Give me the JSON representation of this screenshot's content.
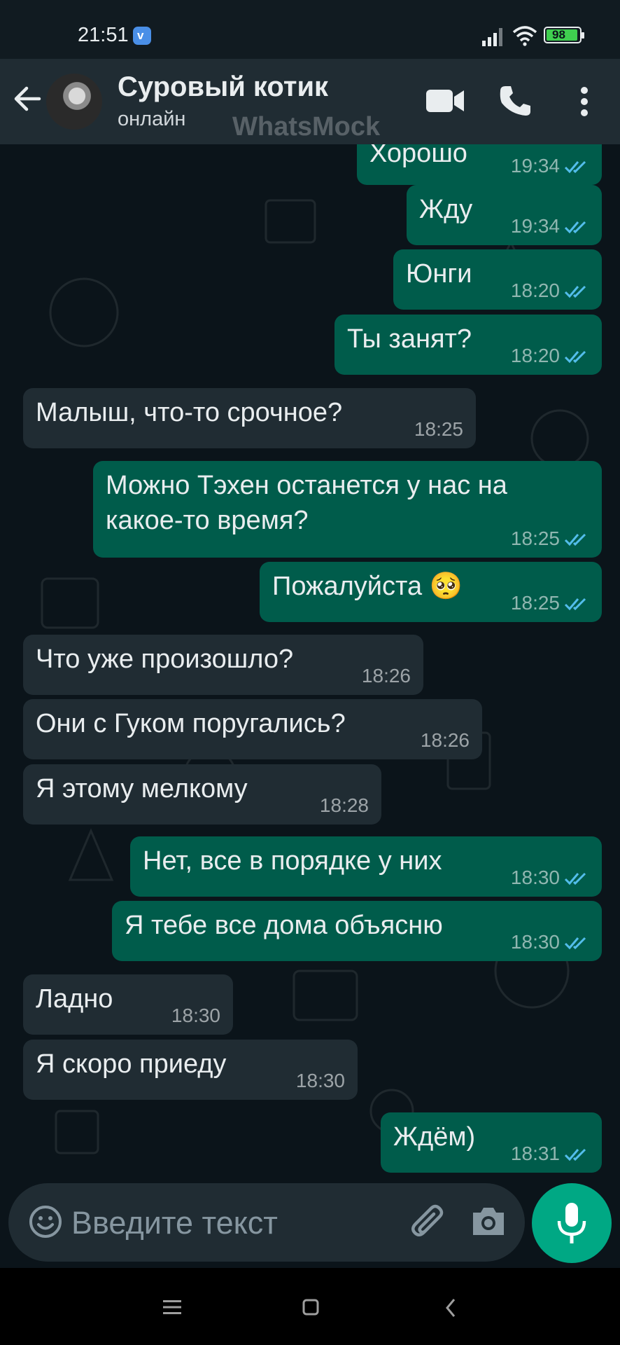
{
  "status_bar": {
    "time": "21:51",
    "battery": "98",
    "app_icon": "v"
  },
  "header": {
    "contact_name": "Суровый котик",
    "contact_status": "онлайн",
    "watermark": "WhatsMock"
  },
  "messages": [
    {
      "text": "Хорошо",
      "time": "19:34",
      "dir": "out",
      "read": true
    },
    {
      "text": "Жду",
      "time": "19:34",
      "dir": "out",
      "read": true
    },
    {
      "text": "Юнги",
      "time": "18:20",
      "dir": "out",
      "read": true
    },
    {
      "text": "Ты занят?",
      "time": "18:20",
      "dir": "out",
      "read": true
    },
    {
      "text": "Малыш, что-то срочное?",
      "time": "18:25",
      "dir": "in"
    },
    {
      "text": "Можно Тэхен останется у нас на",
      "text2": "какое-то время?",
      "time": "18:25",
      "dir": "out",
      "read": true
    },
    {
      "text": "Пожалуйста 🥺",
      "time": "18:25",
      "dir": "out",
      "read": true
    },
    {
      "text": "Что уже произошло?",
      "time": "18:26",
      "dir": "in"
    },
    {
      "text": "Они с Гуком поругались?",
      "time": "18:26",
      "dir": "in"
    },
    {
      "text": "Я этому мелкому",
      "time": "18:28",
      "dir": "in"
    },
    {
      "text": "Нет, все в порядке у них",
      "time": "18:30",
      "dir": "out",
      "read": true
    },
    {
      "text": "Я тебе все дома объясню",
      "time": "18:30",
      "dir": "out",
      "read": true
    },
    {
      "text": "Ладно",
      "time": "18:30",
      "dir": "in"
    },
    {
      "text": "Я скоро приеду",
      "time": "18:30",
      "dir": "in"
    },
    {
      "text": "Ждём)",
      "time": "18:31",
      "dir": "out",
      "read": true
    }
  ],
  "composer": {
    "placeholder": "Введите текст"
  },
  "colors": {
    "outgoing": "#005c4b",
    "incoming": "#202c33",
    "tick_read": "#53bdeb",
    "accent": "#00a884"
  }
}
